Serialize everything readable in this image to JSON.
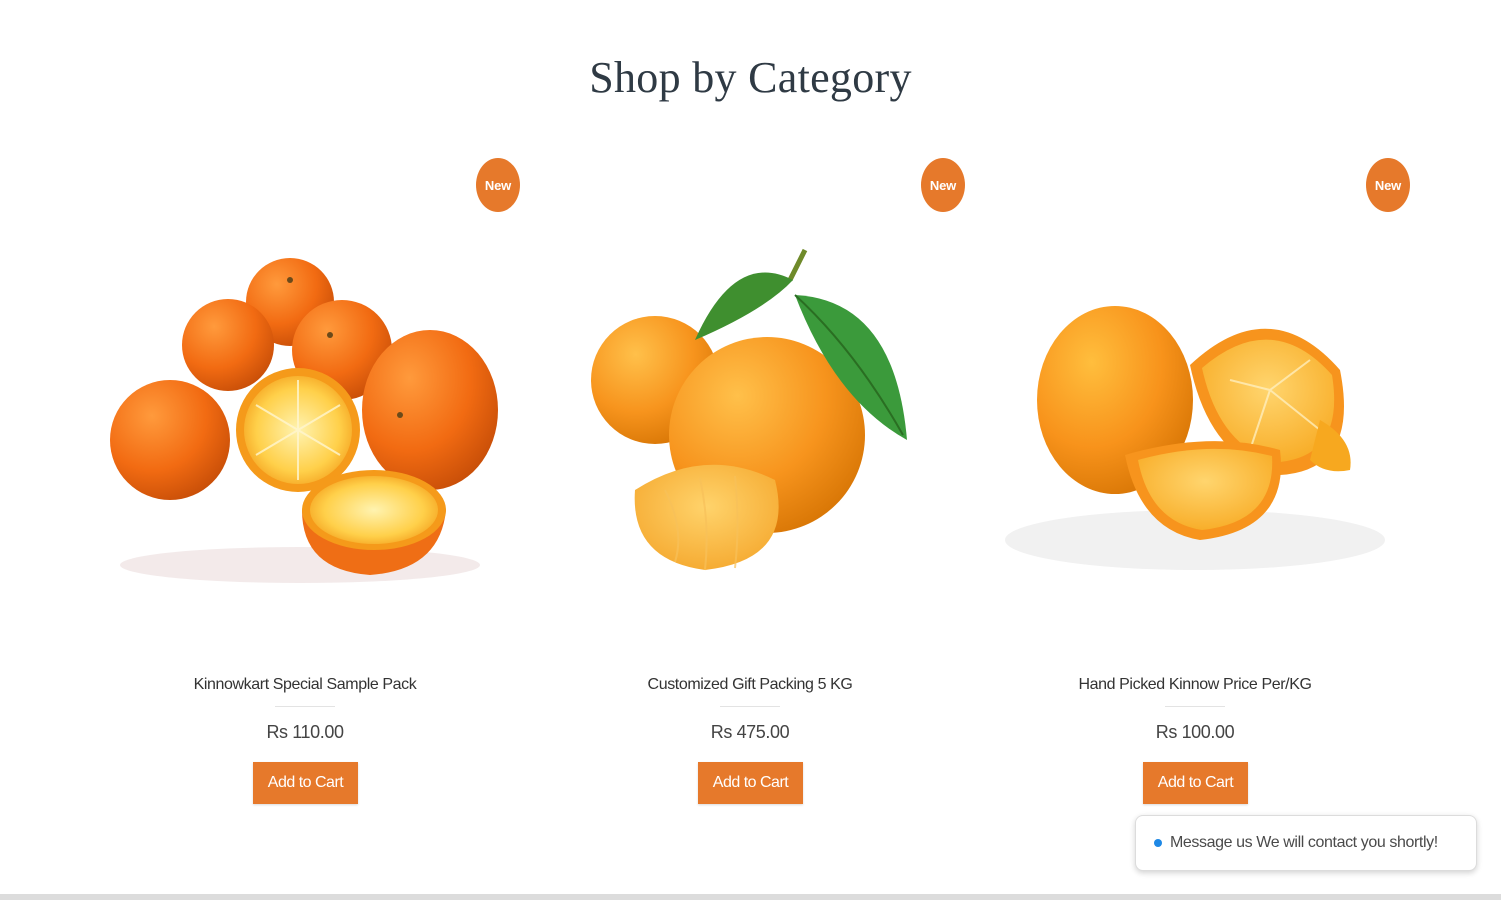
{
  "section": {
    "title": "Shop by Category"
  },
  "colors": {
    "accent": "#e6792b",
    "chat_dot": "#1e88e5"
  },
  "products": [
    {
      "badge": "New",
      "name": "Kinnowkart Special Sample Pack",
      "price": "Rs 110.00",
      "cta": "Add to Cart",
      "image_icon": "oranges-halved-image"
    },
    {
      "badge": "New",
      "name": "Customized Gift Packing 5 KG",
      "price": "Rs 475.00",
      "cta": "Add to Cart",
      "image_icon": "oranges-with-leaves-image"
    },
    {
      "badge": "New",
      "name": "Hand Picked Kinnow Price Per/KG",
      "price": "Rs 100.00",
      "cta": "Add to Cart",
      "image_icon": "orange-segments-image"
    }
  ],
  "chat": {
    "message": "Message us We will contact you shortly!"
  }
}
